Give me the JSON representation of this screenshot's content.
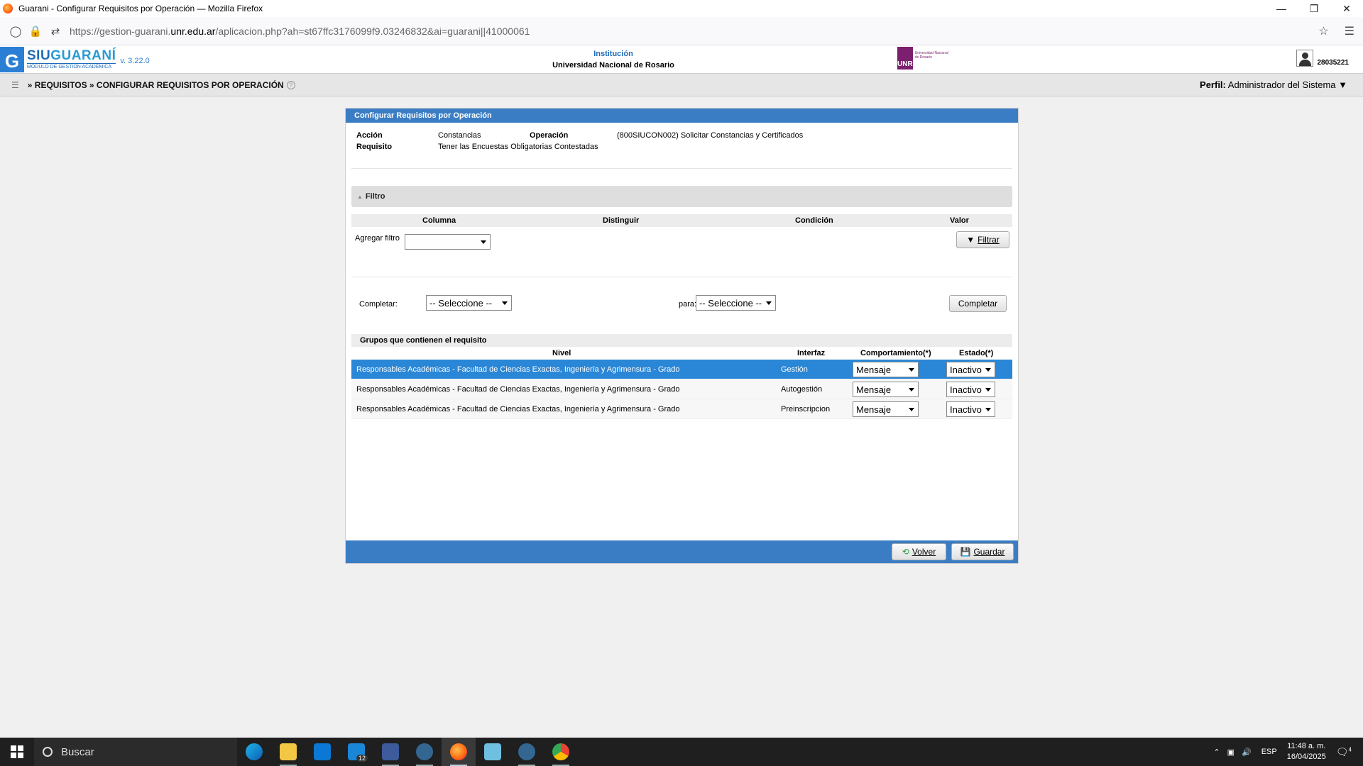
{
  "browser": {
    "title": "Guarani - Configurar Requisitos por Operación — Mozilla Firefox",
    "url_prefix": "https://gestion-guarani.",
    "url_domain": "unr.edu.ar",
    "url_suffix": "/aplicacion.php?ah=st67ffc3176099f9.03246832&ai=guarani||41000061"
  },
  "header": {
    "brand_siu": "SIU",
    "brand_guarani": "GUARANÍ",
    "brand_sub": "MÓDULO DE GESTIÓN ACADÉMICA",
    "version": "v. 3.22.0",
    "inst_label": "Institución",
    "inst_name": "Universidad Nacional de Rosario",
    "unr_block": "UNR",
    "unr_text": "Universidad Nacional de Rosario",
    "user_id": "28035221"
  },
  "breadcrumb": {
    "text": "» REQUISITOS » CONFIGURAR REQUISITOS POR OPERACIÓN",
    "help": "?",
    "perfil_label": "Perfil:",
    "perfil_value": "Administrador del Sistema"
  },
  "panel": {
    "title": "Configurar Requisitos por Operación",
    "accion_label": "Acción",
    "accion_value": "Constancias",
    "operacion_label": "Operación",
    "operacion_value": "(800SIUCON002) Solicitar Constancias y Certificados",
    "requisito_label": "Requisito",
    "requisito_value": "Tener las Encuestas Obligatorias Contestadas"
  },
  "filtro": {
    "title": "Filtro",
    "col_columna": "Columna",
    "col_distinguir": "Distinguir",
    "col_condicion": "Condición",
    "col_valor": "Valor",
    "agregar_label": "Agregar filtro",
    "agregar_value": "",
    "filtrar_button": "Filtrar"
  },
  "completar": {
    "label": "Completar:",
    "select1": "-- Seleccione --",
    "para_label": "para:",
    "select2": "-- Seleccione --",
    "button": "Completar"
  },
  "grupos": {
    "title": "Grupos que contienen el requisito",
    "col_nivel": "Nivel",
    "col_interfaz": "Interfaz",
    "col_comportamiento": "Comportamiento(*)",
    "col_estado": "Estado(*)",
    "rows": [
      {
        "nivel": "Responsables Académicas - Facultad de Ciencias Exactas, Ingeniería y Agrimensura - Grado",
        "interfaz": "Gestión",
        "comportamiento": "Mensaje",
        "estado": "Inactivo"
      },
      {
        "nivel": "Responsables Académicas - Facultad de Ciencias Exactas, Ingeniería y Agrimensura - Grado",
        "interfaz": "Autogestión",
        "comportamiento": "Mensaje",
        "estado": "Inactivo"
      },
      {
        "nivel": "Responsables Académicas - Facultad de Ciencias Exactas, Ingeniería y Agrimensura - Grado",
        "interfaz": "Preinscripcion",
        "comportamiento": "Mensaje",
        "estado": "Inactivo"
      }
    ]
  },
  "footer": {
    "volver": "Volver",
    "guardar": "Guardar"
  },
  "taskbar": {
    "search": "Buscar",
    "lang": "ESP",
    "time": "11:48 a. m.",
    "date": "16/04/2025",
    "mail_badge": "12",
    "notif_badge": "4"
  }
}
